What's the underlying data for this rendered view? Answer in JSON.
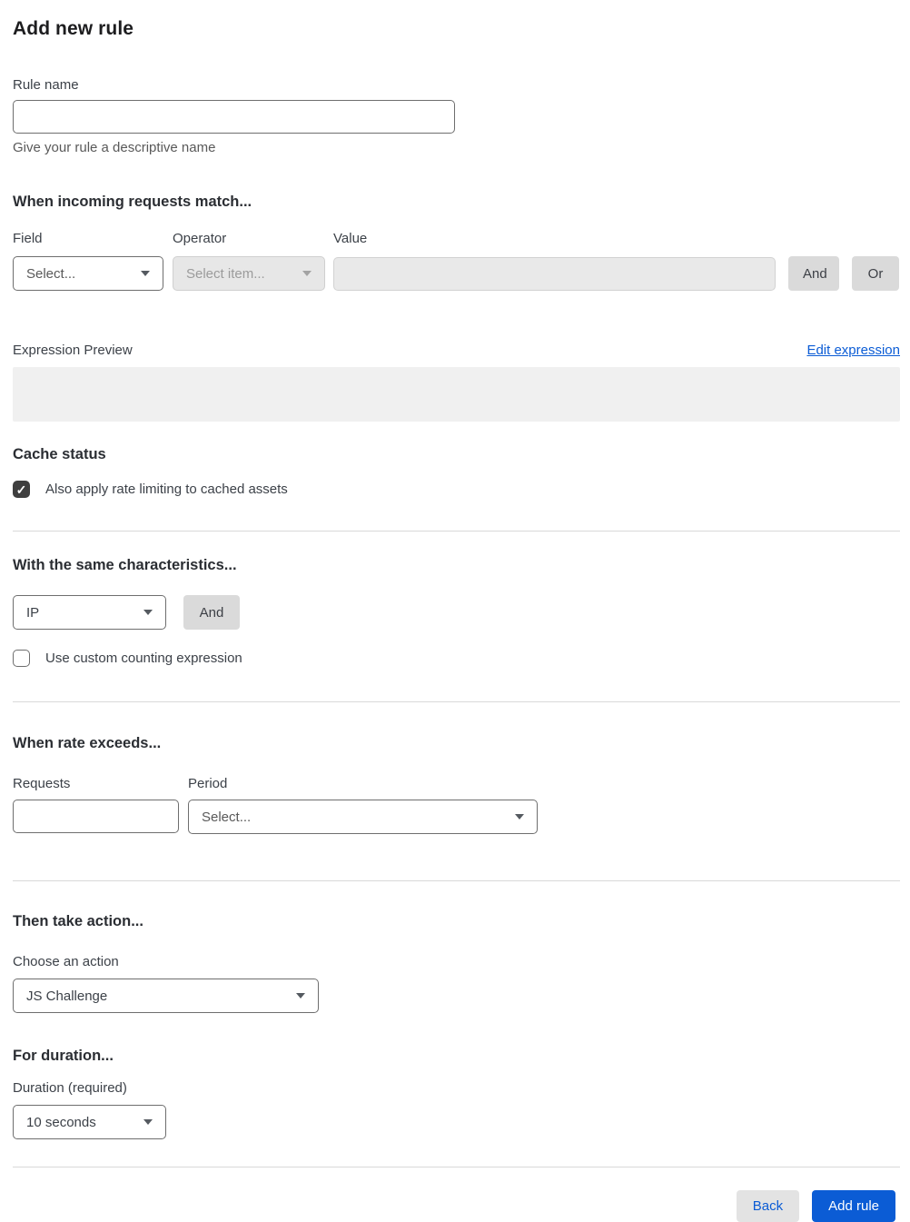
{
  "page": {
    "title": "Add new rule"
  },
  "rule_name": {
    "label": "Rule name",
    "value": "",
    "helper": "Give your rule a descriptive name"
  },
  "match": {
    "heading": "When incoming requests match...",
    "field": {
      "label": "Field",
      "selected": "Select..."
    },
    "operator": {
      "label": "Operator",
      "selected": "Select item...",
      "disabled": true
    },
    "value": {
      "label": "Value",
      "value": "",
      "disabled": true
    },
    "and_label": "And",
    "or_label": "Or"
  },
  "expression": {
    "label": "Expression Preview",
    "edit_link": "Edit expression",
    "preview_value": ""
  },
  "cache": {
    "heading": "Cache status",
    "checkbox_label": "Also apply rate limiting to cached assets",
    "checked": true,
    "check_glyph": "✓"
  },
  "characteristics": {
    "heading": "With the same characteristics...",
    "selected": "IP",
    "and_label": "And",
    "checkbox_label": "Use custom counting expression",
    "checked": false
  },
  "rate": {
    "heading": "When rate exceeds...",
    "requests_label": "Requests",
    "requests_value": "",
    "period_label": "Period",
    "period_selected": "Select..."
  },
  "action": {
    "heading": "Then take action...",
    "label": "Choose an action",
    "selected": "JS Challenge"
  },
  "duration": {
    "heading": "For duration...",
    "label": "Duration (required)",
    "selected": "10 seconds"
  },
  "footer": {
    "back_label": "Back",
    "submit_label": "Add rule"
  },
  "colors": {
    "accent_blue": "#0b5cd5",
    "checkbox_checked": "#3f3f3f",
    "disabled_gray": "#e7e7e7",
    "divider": "#d9d9d9"
  }
}
